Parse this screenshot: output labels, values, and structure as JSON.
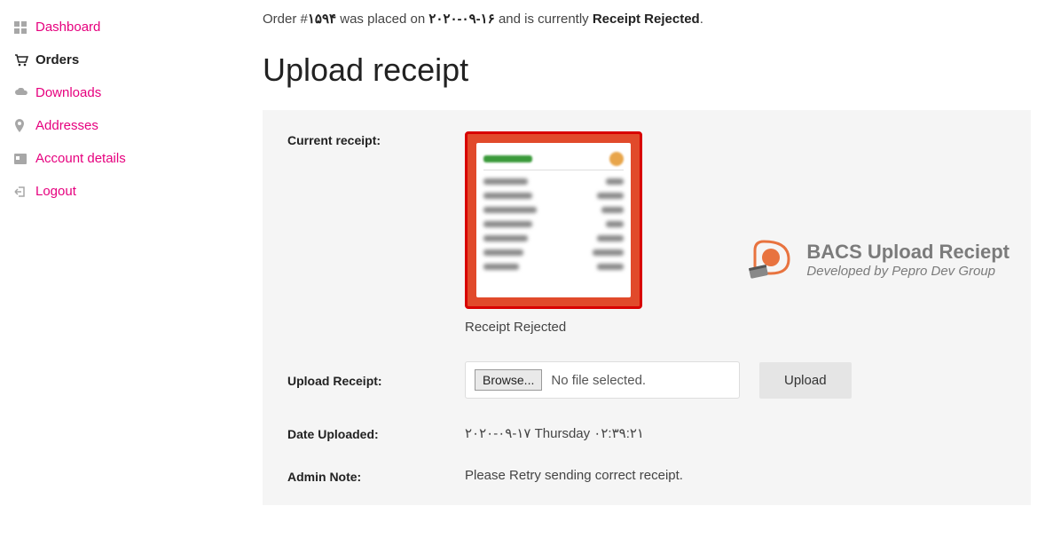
{
  "sidebar": {
    "items": [
      {
        "icon": "dashboard",
        "label": "Dashboard"
      },
      {
        "icon": "cart",
        "label": "Orders"
      },
      {
        "icon": "cloud-down",
        "label": "Downloads"
      },
      {
        "icon": "pin",
        "label": "Addresses"
      },
      {
        "icon": "card",
        "label": "Account details"
      },
      {
        "icon": "logout",
        "label": "Logout"
      }
    ]
  },
  "order": {
    "prefix": "Order #",
    "number": "۱۵۹۴",
    "mid1": " was placed on ",
    "date": "۲۰۲۰-۰۹-۱۶",
    "mid2": " and is currently ",
    "status": "Receipt Rejected",
    "suffix": "."
  },
  "title": "Upload receipt",
  "rows": {
    "current_label": "Current receipt:",
    "current_status": "Receipt Rejected",
    "upload_label": "Upload Receipt:",
    "browse": "Browse...",
    "no_file": "No file selected.",
    "upload_btn": "Upload",
    "date_label": "Date Uploaded:",
    "date_value": "۲۰۲۰-۰۹-۱۷ Thursday ۰۲:۳۹:۲۱",
    "note_label": "Admin Note:",
    "note_value": "Please Retry sending correct receipt."
  },
  "brand": {
    "line1": "BACS Upload Reciept",
    "line2": "Developed by Pepro Dev Group"
  }
}
